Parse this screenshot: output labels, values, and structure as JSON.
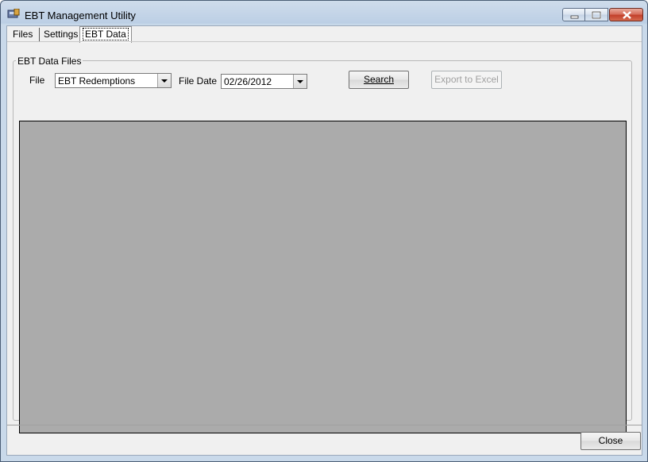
{
  "window": {
    "title": "EBT Management Utility"
  },
  "tabs": [
    {
      "label": "Files"
    },
    {
      "label": "Settings"
    },
    {
      "label": "EBT Data",
      "selected": true
    }
  ],
  "group": {
    "label": "EBT Data Files",
    "file_label": "File",
    "file_value": "EBT Redemptions",
    "date_label": "File Date",
    "date_value": "02/26/2012",
    "search_button": "Search",
    "export_button": "Export to Excel"
  },
  "footer": {
    "close_button": "Close"
  },
  "colors": {
    "grid_background": "#ababab",
    "client_background": "#f0f0f0"
  }
}
